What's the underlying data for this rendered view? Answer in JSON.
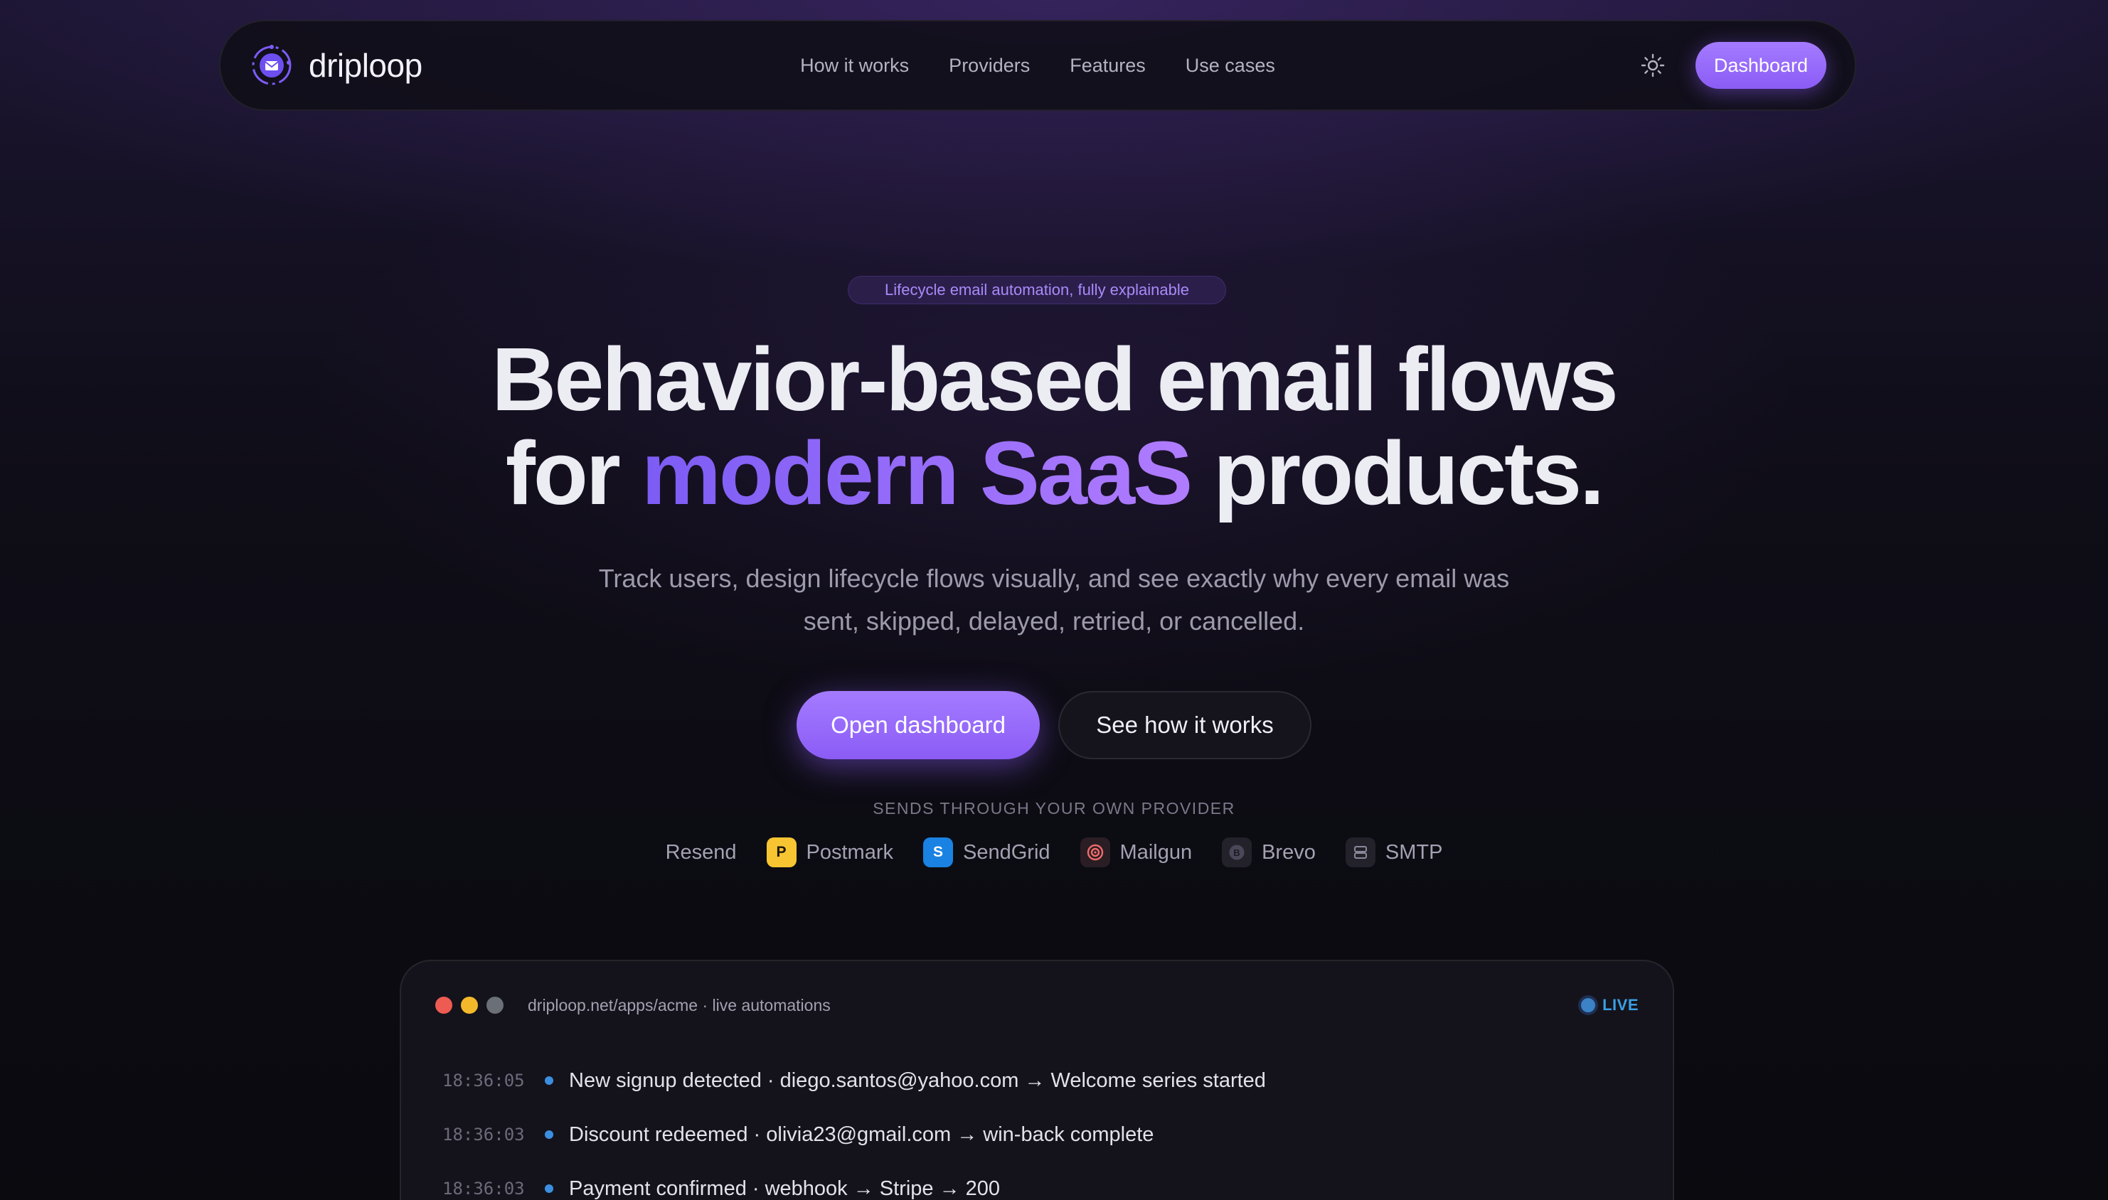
{
  "nav": {
    "brand": "driploop",
    "links": [
      "How it works",
      "Providers",
      "Features",
      "Use cases"
    ],
    "dashboard_label": "Dashboard"
  },
  "hero": {
    "badge": "Lifecycle email automation, fully explainable",
    "title_line1": "Behavior-based email flows",
    "title_line2_pre": "for ",
    "title_line2_accent": "modern SaaS",
    "title_line2_post": " products.",
    "subtitle": "Track users, design lifecycle flows visually, and see exactly why every email was sent, skipped, delayed, retried, or cancelled.",
    "cta_primary": "Open dashboard",
    "cta_secondary": "See how it works"
  },
  "providers": {
    "label": "SENDS THROUGH YOUR OWN PROVIDER",
    "items": [
      {
        "name": "Resend",
        "icon": "",
        "icon_label": "",
        "icon_bg": "",
        "icon_fg": ""
      },
      {
        "name": "Postmark",
        "icon": "postmark-icon",
        "icon_label": "P",
        "icon_bg": "#f7c531",
        "icon_fg": "#1a1608"
      },
      {
        "name": "SendGrid",
        "icon": "sendgrid-icon",
        "icon_label": "S",
        "icon_bg": "#1a82e2",
        "icon_fg": "#ffffff"
      },
      {
        "name": "Mailgun",
        "icon": "mailgun-icon",
        "icon_label": "@",
        "icon_bg": "#2a1e24",
        "icon_fg": "#f06b6b"
      },
      {
        "name": "Brevo",
        "icon": "brevo-icon",
        "icon_label": "B",
        "icon_bg": "#23222b",
        "icon_fg": "#8a8898"
      },
      {
        "name": "SMTP",
        "icon": "server-icon",
        "icon_label": "",
        "icon_bg": "#23222b",
        "icon_fg": "#8a8898"
      }
    ]
  },
  "console": {
    "url": "driploop.net/apps/acme · live automations",
    "status": "LIVE",
    "rows": [
      {
        "time": "18:36:05",
        "text": "New signup detected · diego.santos@yahoo.com → Welcome series started"
      },
      {
        "time": "18:36:03",
        "text": "Discount redeemed · olivia23@gmail.com → win-back complete"
      },
      {
        "time": "18:36:03",
        "text": "Payment confirmed · webhook → Stripe → 200"
      }
    ]
  },
  "colors": {
    "accent": "#8b5cf6",
    "accent_light": "#a78bfa",
    "live": "#3b9fe6",
    "background": "#0a0a0f"
  }
}
